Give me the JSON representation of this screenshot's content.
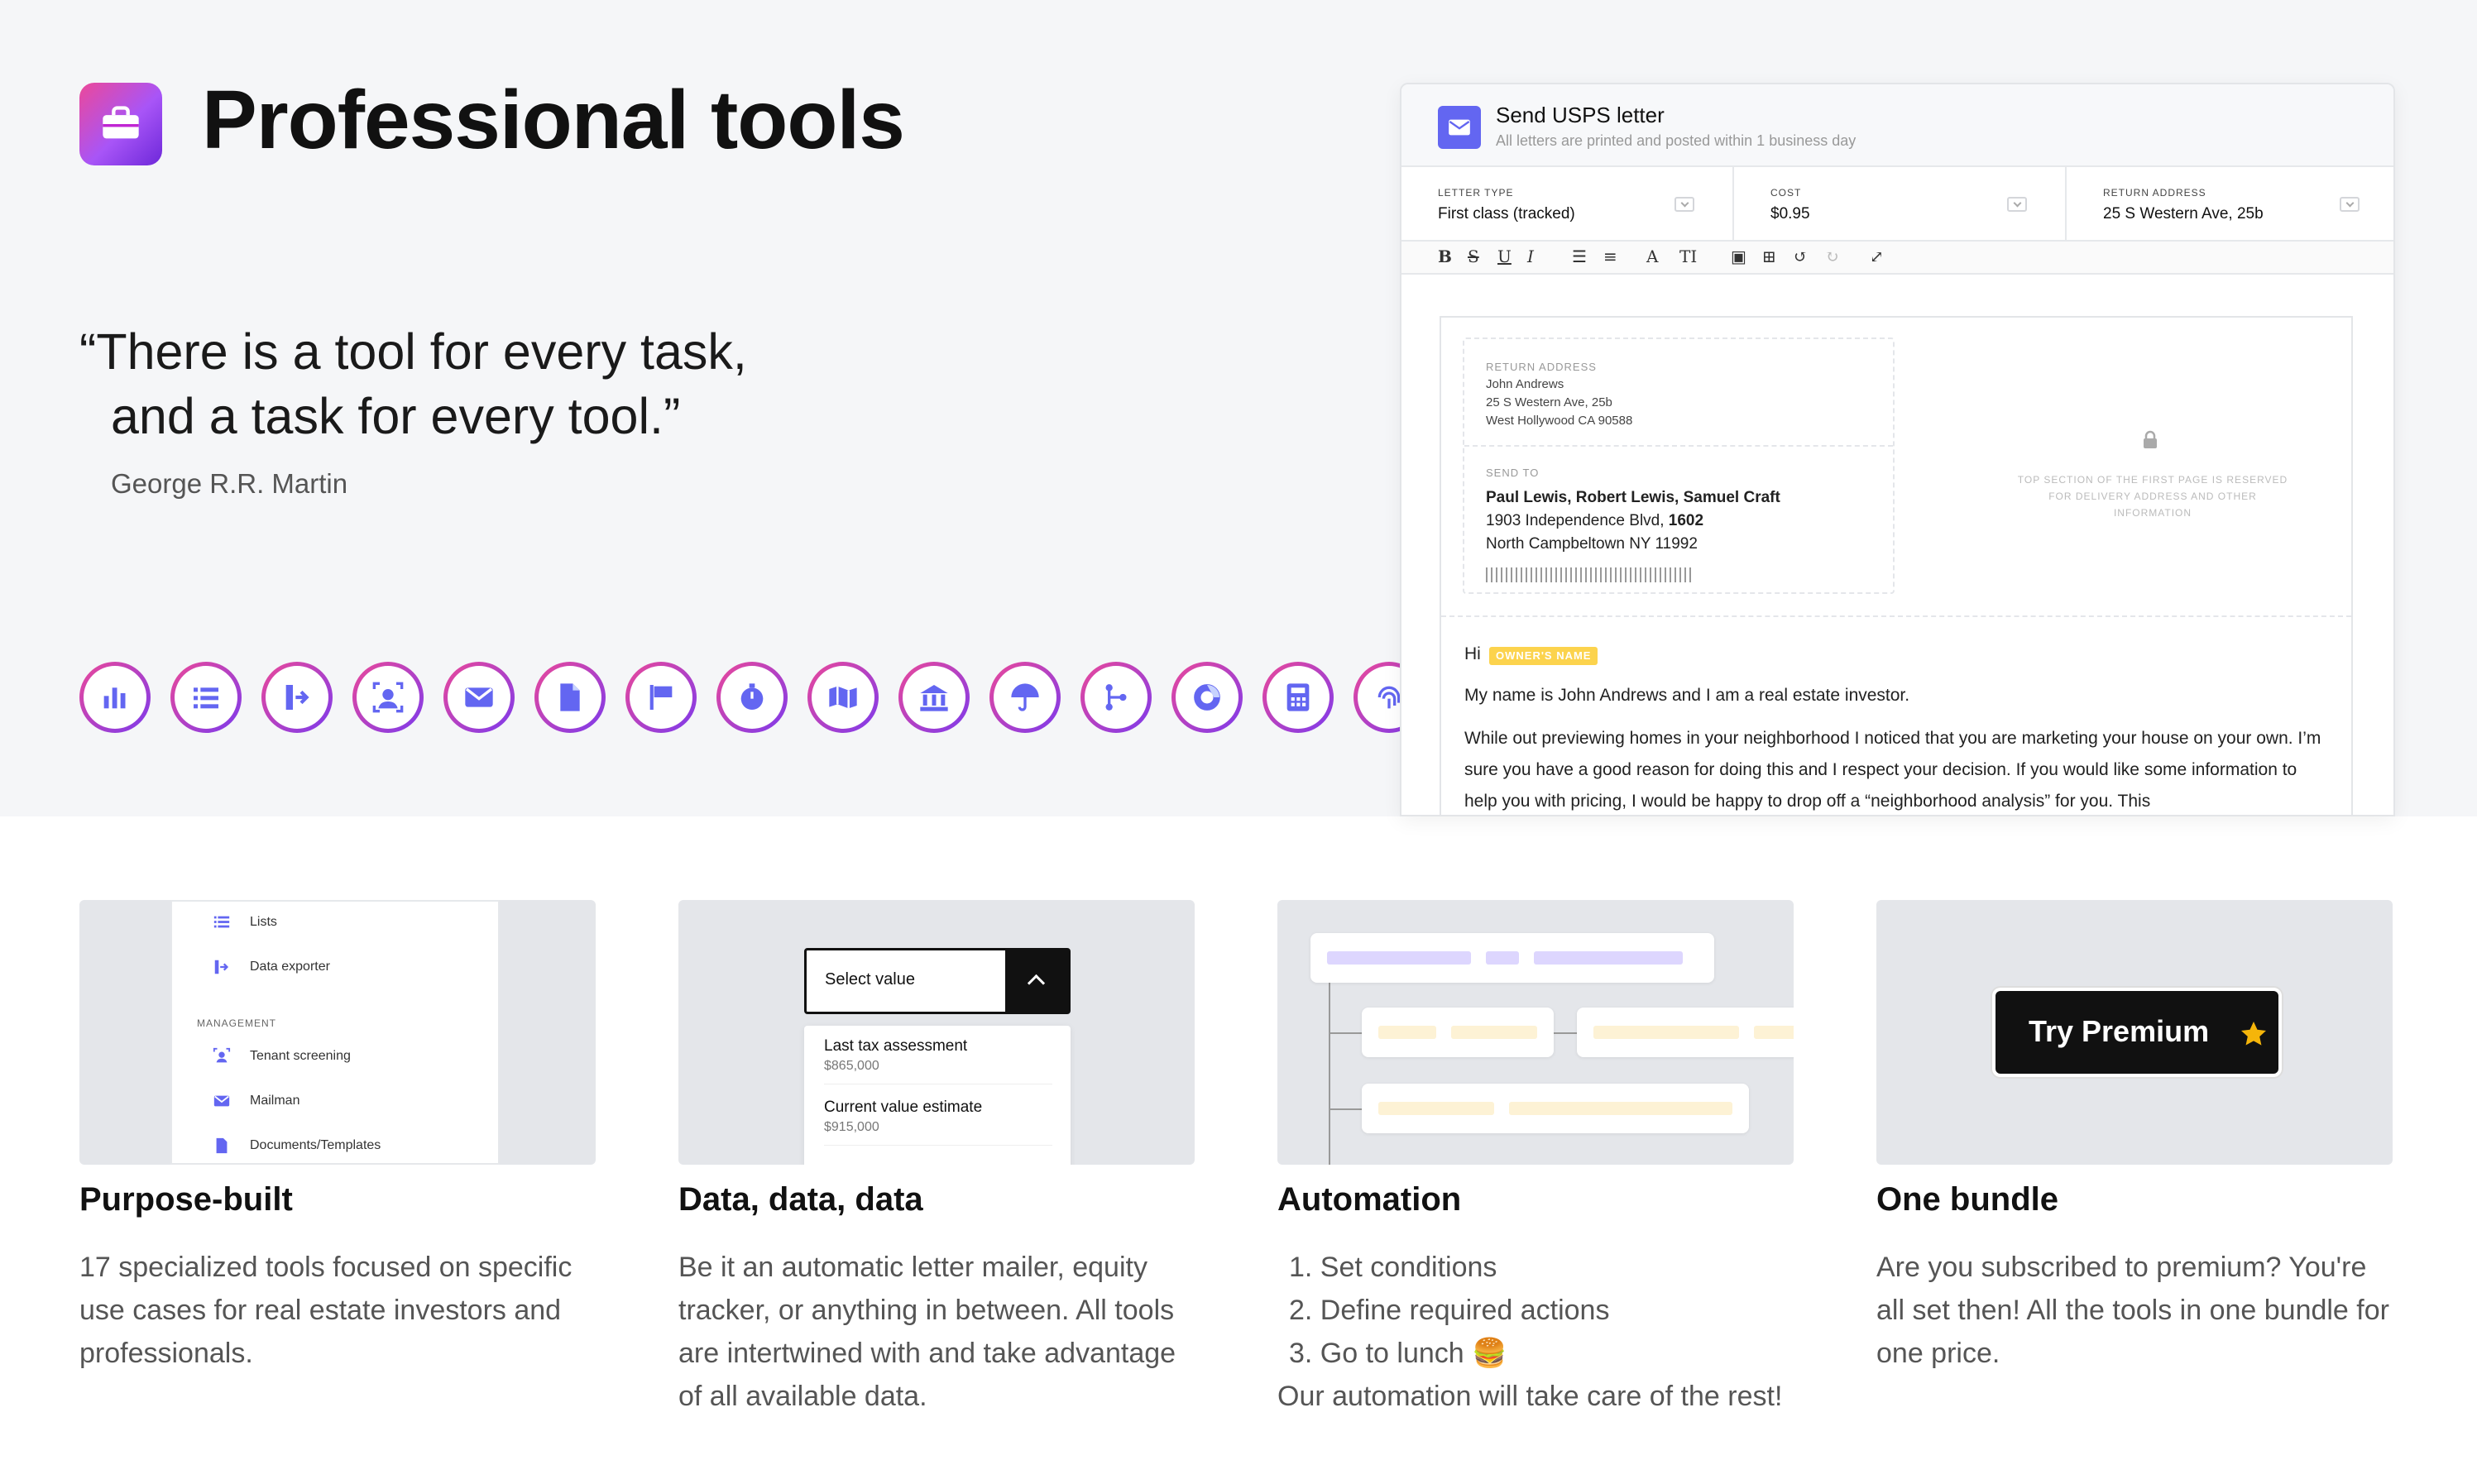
{
  "hero": {
    "title": "Professional tools",
    "quote_line1": "“There is a tool for every task,",
    "quote_line2": "and a task for every tool.”",
    "author": "George R.R. Martin",
    "tool_icons": [
      "chart-icon",
      "list-icon",
      "export-icon",
      "tenant-screening-icon",
      "mail-icon",
      "document-icon",
      "flag-icon",
      "timer-icon",
      "map-icon",
      "bank-icon",
      "umbrella-icon",
      "branch-icon",
      "donut-chart-icon",
      "calculator-icon",
      "fingerprint-icon"
    ]
  },
  "letter": {
    "title": "Send USPS letter",
    "subtitle": "All letters are printed and posted within 1 business day",
    "fields": [
      {
        "key": "LETTER TYPE",
        "value": "First class (tracked)"
      },
      {
        "key": "COST",
        "value": "$0.95"
      },
      {
        "key": "RETURN ADDRESS",
        "value": "25 S Western Ave, 25b"
      }
    ],
    "toolbar": [
      "B",
      "S",
      "U",
      "I",
      "bullet-list-icon",
      "numbered-list-icon",
      "A",
      "TI",
      "image-icon",
      "table-icon",
      "undo-icon",
      "redo-icon",
      "fullscreen-icon"
    ],
    "return_label": "RETURN ADDRESS",
    "return_lines": [
      "John Andrews",
      "25 S Western Ave, 25b",
      "West Hollywood CA 90588"
    ],
    "send_label": "SEND TO",
    "send_name": "Paul Lewis, Robert Lewis, Samuel Craft",
    "send_line1": "1903 Independence Blvd,",
    "send_line1_bold": "1602",
    "send_line2": "North Campbeltown NY 11992",
    "reserved_note": "TOP SECTION OF THE FIRST PAGE IS RESERVED FOR DELIVERY ADDRESS AND OTHER INFORMATION",
    "greeting": "Hi",
    "owner_tag": "OWNER'S NAME",
    "para1": "My name is John Andrews and I am a real estate investor.",
    "para2": "While out previewing homes in your neighborhood I noticed that you are marketing your house on your own. I’m sure you have a good reason for doing this and I respect your decision. If you would like some information to help you with pricing, I would be happy to drop off a “neighborhood analysis” for you. This"
  },
  "cards": [
    {
      "title": "Purpose-built",
      "text": "17 specialized tools focused on specific use cases for real estate investors and professionals.",
      "menu": {
        "items_top": [
          "Lists",
          "Data exporter"
        ],
        "section": "MANAGEMENT",
        "items_bottom": [
          "Tenant screening",
          "Mailman",
          "Documents/Templates"
        ]
      }
    },
    {
      "title": "Data, data, data",
      "text": "Be it an automatic letter mailer, equity tracker, or anything in between. All tools are intertwined with and take advantage of all available data.",
      "select": {
        "label": "Select value",
        "options": [
          {
            "name": "Last tax assessment",
            "value": "$865,000"
          },
          {
            "name": "Current value estimate",
            "value": "$915,000"
          }
        ]
      }
    },
    {
      "title": "Automation",
      "steps": [
        "1.  Set conditions",
        "2.  Define required actions",
        "3.  Go to lunch 🍔"
      ],
      "text": "Our automation will take care of the rest!"
    },
    {
      "title": "One bundle",
      "text": "Are you subscribed to premium? You're all set then! All the tools in one bundle for one price.",
      "button": "Try Premium"
    }
  ],
  "colors": {
    "accent": "#6366f1",
    "gradient_start": "#ec4899",
    "gradient_end": "#7c3aed",
    "star": "#f5b50a"
  }
}
